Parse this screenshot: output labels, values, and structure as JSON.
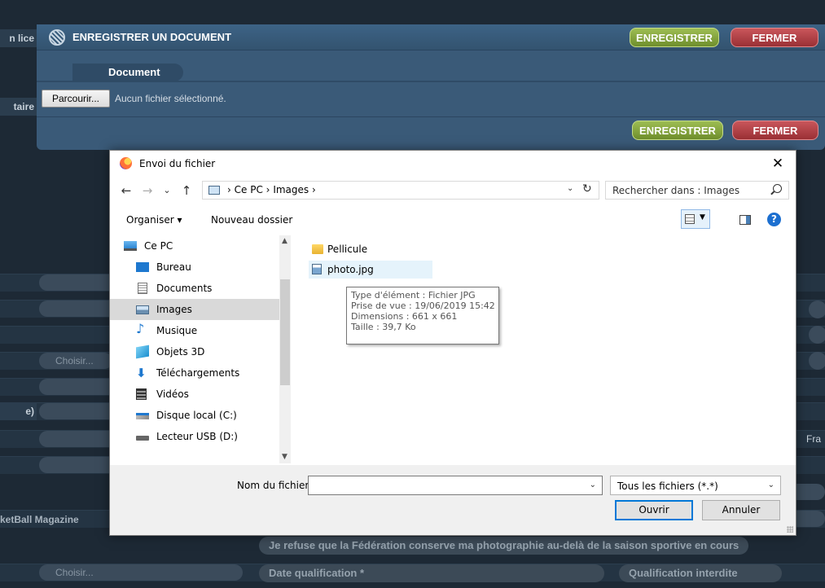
{
  "modal": {
    "title": "ENREGISTRER UN DOCUMENT",
    "save_label": "ENREGISTRER",
    "close_label": "FERMER",
    "tab_label": "Document",
    "browse_label": "Parcourir...",
    "no_file_text": "Aucun fichier sélectionné."
  },
  "background": {
    "left_labels": [
      "n lice",
      "taire",
      "e)",
      "ketBall Magazine"
    ],
    "choose_label": "Choisir...",
    "choose_label_2": "Choisir...",
    "right_text": "Fra",
    "refuse_text": "Je refuse que la Fédération conserve ma photographie au-delà de la saison sportive en cours",
    "date_qualification": "Date qualification *",
    "qualification_interdite": "Qualification interdite"
  },
  "dialog": {
    "title": "Envoi du fichier",
    "close_glyph": "✕",
    "nav": {
      "back": "←",
      "forward": "→",
      "recent": "⌄",
      "up": "↑"
    },
    "breadcrumb": [
      "Ce PC",
      "Images"
    ],
    "breadcrumb_sep": "›",
    "refresh_glyph": "↻",
    "dropdown_glyph": "⌄",
    "search_placeholder": "Rechercher dans : Images",
    "toolbar": {
      "organize": "Organiser ▾",
      "new_folder": "Nouveau dossier",
      "help": "?"
    },
    "nav_pane": [
      {
        "label": "Ce PC",
        "icon": "computer-icon"
      },
      {
        "label": "Bureau",
        "icon": "desktop-icon"
      },
      {
        "label": "Documents",
        "icon": "documents-icon"
      },
      {
        "label": "Images",
        "icon": "images-icon",
        "selected": true
      },
      {
        "label": "Musique",
        "icon": "music-icon"
      },
      {
        "label": "Objets 3D",
        "icon": "3d-objects-icon"
      },
      {
        "label": "Téléchargements",
        "icon": "downloads-icon"
      },
      {
        "label": "Vidéos",
        "icon": "videos-icon"
      },
      {
        "label": "Disque local (C:)",
        "icon": "local-disk-icon"
      },
      {
        "label": "Lecteur USB (D:)",
        "icon": "usb-drive-icon"
      }
    ],
    "files": [
      {
        "name": "Pellicule",
        "type": "folder",
        "icon": "folder-icon"
      },
      {
        "name": "photo.jpg",
        "type": "image",
        "icon": "image-file-icon"
      }
    ],
    "tooltip": {
      "type": "Type d'élément : Fichier JPG",
      "taken": "Prise de vue : 19/06/2019 15:42",
      "dimensions": "Dimensions : 661 x 661",
      "size": "Taille : 39,7 Ko"
    },
    "filename_label": "Nom du fichier :",
    "filename_value": "",
    "filter_value": "Tous les fichiers (*.*)",
    "open_label": "Ouvrir",
    "cancel_label": "Annuler"
  },
  "colors": {
    "accent": "#0078d7",
    "save_green": "#8aab41",
    "close_red": "#b8444a",
    "modal_blue": "#3a5a78"
  }
}
